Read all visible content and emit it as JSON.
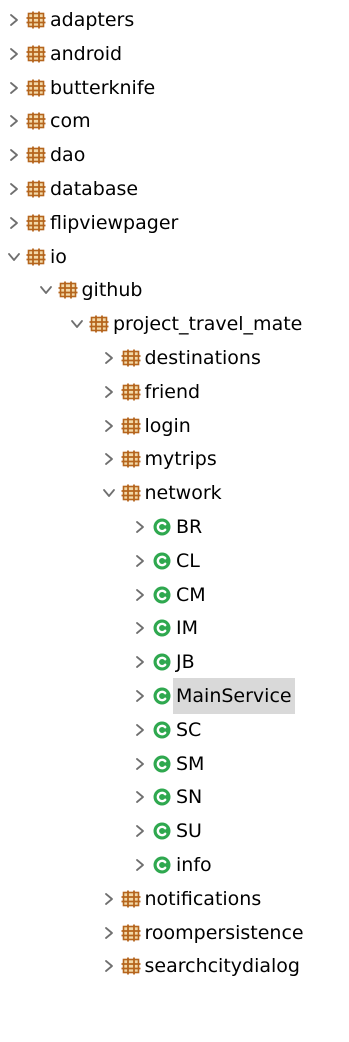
{
  "colors": {
    "package_icon": "#b5651d",
    "class_icon": "#2fa84f",
    "chevron": "#6f6f6f",
    "selection": "#d9d9d9"
  },
  "tree": [
    {
      "label": "adapters",
      "level": 0,
      "expanded": false,
      "icon": "package-icon"
    },
    {
      "label": "android",
      "level": 0,
      "expanded": false,
      "icon": "package-icon"
    },
    {
      "label": "butterknife",
      "level": 0,
      "expanded": false,
      "icon": "package-icon"
    },
    {
      "label": "com",
      "level": 0,
      "expanded": false,
      "icon": "package-icon"
    },
    {
      "label": "dao",
      "level": 0,
      "expanded": false,
      "icon": "package-icon"
    },
    {
      "label": "database",
      "level": 0,
      "expanded": false,
      "icon": "package-icon"
    },
    {
      "label": "flipviewpager",
      "level": 0,
      "expanded": false,
      "icon": "package-icon"
    },
    {
      "label": "io",
      "level": 0,
      "expanded": true,
      "icon": "package-icon"
    },
    {
      "label": "github",
      "level": 1,
      "expanded": true,
      "icon": "package-icon"
    },
    {
      "label": "project_travel_mate",
      "level": 2,
      "expanded": true,
      "icon": "package-icon"
    },
    {
      "label": "destinations",
      "level": 3,
      "expanded": false,
      "icon": "package-icon"
    },
    {
      "label": "friend",
      "level": 3,
      "expanded": false,
      "icon": "package-icon"
    },
    {
      "label": "login",
      "level": 3,
      "expanded": false,
      "icon": "package-icon"
    },
    {
      "label": "mytrips",
      "level": 3,
      "expanded": false,
      "icon": "package-icon"
    },
    {
      "label": "network",
      "level": 3,
      "expanded": true,
      "icon": "package-icon"
    },
    {
      "label": "BR",
      "level": 4,
      "expanded": false,
      "icon": "class-icon"
    },
    {
      "label": "CL",
      "level": 4,
      "expanded": false,
      "icon": "class-icon"
    },
    {
      "label": "CM",
      "level": 4,
      "expanded": false,
      "icon": "class-icon"
    },
    {
      "label": "IM",
      "level": 4,
      "expanded": false,
      "icon": "class-icon"
    },
    {
      "label": "JB",
      "level": 4,
      "expanded": false,
      "icon": "class-icon"
    },
    {
      "label": "MainService",
      "level": 4,
      "expanded": false,
      "icon": "class-icon",
      "selected": true
    },
    {
      "label": "SC",
      "level": 4,
      "expanded": false,
      "icon": "class-icon"
    },
    {
      "label": "SM",
      "level": 4,
      "expanded": false,
      "icon": "class-icon"
    },
    {
      "label": "SN",
      "level": 4,
      "expanded": false,
      "icon": "class-icon"
    },
    {
      "label": "SU",
      "level": 4,
      "expanded": false,
      "icon": "class-icon"
    },
    {
      "label": "info",
      "level": 4,
      "expanded": false,
      "icon": "class-icon"
    },
    {
      "label": "notifications",
      "level": 3,
      "expanded": false,
      "icon": "package-icon"
    },
    {
      "label": "roompersistence",
      "level": 3,
      "expanded": false,
      "icon": "package-icon"
    },
    {
      "label": "searchcitydialog",
      "level": 3,
      "expanded": false,
      "icon": "package-icon"
    }
  ]
}
